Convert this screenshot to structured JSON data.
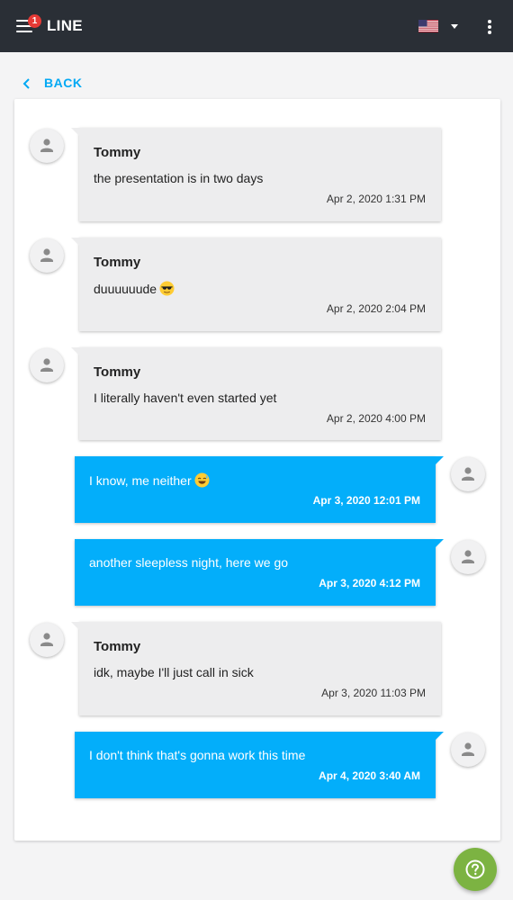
{
  "header": {
    "title": "LINE",
    "notification_count": "1",
    "menu_icon": "hamburger-menu-icon",
    "language_icon": "us-flag-icon",
    "more_icon": "vertical-dots-icon"
  },
  "nav": {
    "back_label": "BACK"
  },
  "messages": [
    {
      "direction": "incoming",
      "sender": "Tommy",
      "text": "the presentation is in two days",
      "time": "Apr 2, 2020 1:31 PM"
    },
    {
      "direction": "incoming",
      "sender": "Tommy",
      "text": "duuuuuude",
      "emoji": "sunglasses-emoji-icon",
      "time": "Apr 2, 2020 2:04 PM"
    },
    {
      "direction": "incoming",
      "sender": "Tommy",
      "text": "I literally haven't even started yet",
      "time": "Apr 2, 2020 4:00 PM"
    },
    {
      "direction": "outgoing",
      "text": "I know, me neither",
      "emoji": "sweat-smile-emoji-icon",
      "time": "Apr 3, 2020 12:01 PM"
    },
    {
      "direction": "outgoing",
      "text": "another sleepless night, here we go",
      "time": "Apr 3, 2020 4:12 PM"
    },
    {
      "direction": "incoming",
      "sender": "Tommy",
      "text": "idk, maybe I'll just call in sick",
      "time": "Apr 3, 2020 11:03 PM"
    },
    {
      "direction": "outgoing",
      "text": "I don't think that's gonna work this time",
      "time": "Apr 4, 2020 3:40 AM"
    }
  ],
  "colors": {
    "topbar": "#2a2f36",
    "accent": "#03a9f4",
    "outgoing_bubble": "#03aefa",
    "incoming_bubble": "#ededee",
    "help_button": "#7cb342",
    "badge": "#e53935"
  },
  "help_icon": "help-circle-icon"
}
